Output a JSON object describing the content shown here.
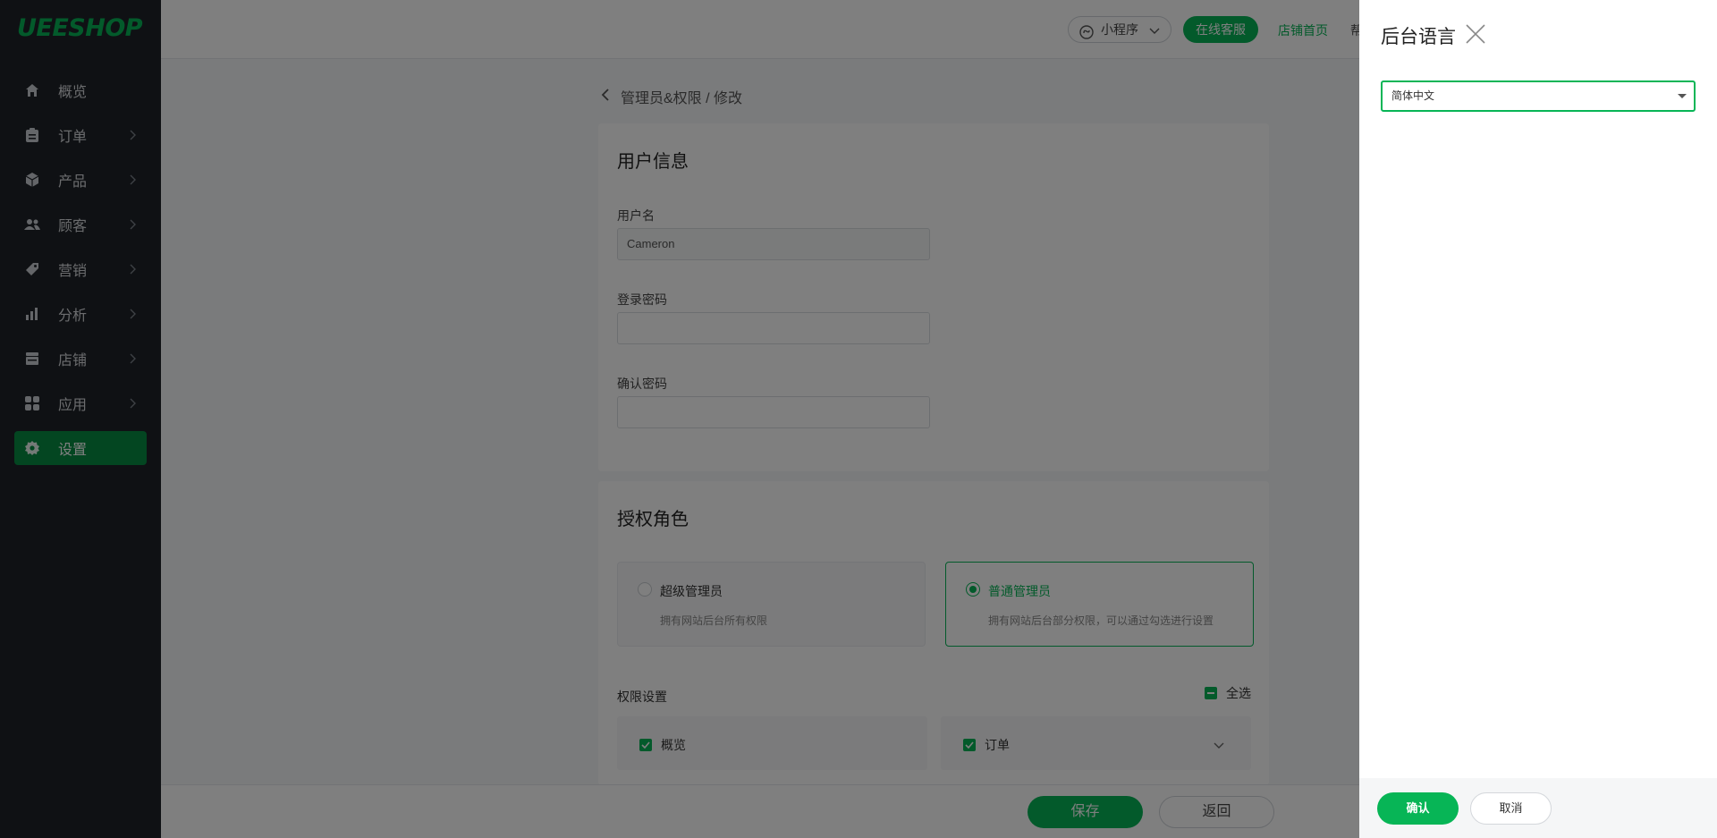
{
  "brand": {
    "logo": "UEESHOP",
    "accent_color": "#07b556",
    "sidebar_bg": "#1e2329"
  },
  "sidebar": {
    "items": [
      {
        "label": "概览",
        "icon": "home-icon",
        "has_submenu": false,
        "active": false
      },
      {
        "label": "订单",
        "icon": "clipboard-icon",
        "has_submenu": true,
        "active": false
      },
      {
        "label": "产品",
        "icon": "box-icon",
        "has_submenu": true,
        "active": false
      },
      {
        "label": "顾客",
        "icon": "users-icon",
        "has_submenu": true,
        "active": false
      },
      {
        "label": "营销",
        "icon": "tag-icon",
        "has_submenu": true,
        "active": false
      },
      {
        "label": "分析",
        "icon": "bar-chart-icon",
        "has_submenu": true,
        "active": false
      },
      {
        "label": "店铺",
        "icon": "store-icon",
        "has_submenu": true,
        "active": false
      },
      {
        "label": "应用",
        "icon": "apps-grid-icon",
        "has_submenu": true,
        "active": false
      },
      {
        "label": "设置",
        "icon": "gear-icon",
        "has_submenu": false,
        "active": true
      }
    ]
  },
  "topbar": {
    "mini_program": "小程序",
    "online_service": "在线客服",
    "shop_home": "店铺首页",
    "truncated": "帮"
  },
  "breadcrumb": {
    "path": "管理员&权限 / 修改"
  },
  "user_info": {
    "title": "用户信息",
    "username_label": "用户名",
    "username_value": "Cameron",
    "password_label": "登录密码",
    "password_value": "",
    "confirm_label": "确认密码",
    "confirm_value": ""
  },
  "roles": {
    "title": "授权角色",
    "super_admin": {
      "title": "超级管理员",
      "desc": "拥有网站后台所有权限",
      "selected": false
    },
    "normal_admin": {
      "title": "普通管理员",
      "desc": "拥有网站后台部分权限，可以通过勾选进行设置",
      "selected": true
    }
  },
  "permissions": {
    "label": "权限设置",
    "select_all": "全选",
    "items": [
      {
        "label": "概览",
        "checked": true
      },
      {
        "label": "订单",
        "checked": true
      }
    ]
  },
  "footer": {
    "save": "保存",
    "back": "返回"
  },
  "drawer": {
    "title": "后台语言",
    "language_value": "简体中文",
    "confirm": "确认",
    "cancel": "取消"
  }
}
